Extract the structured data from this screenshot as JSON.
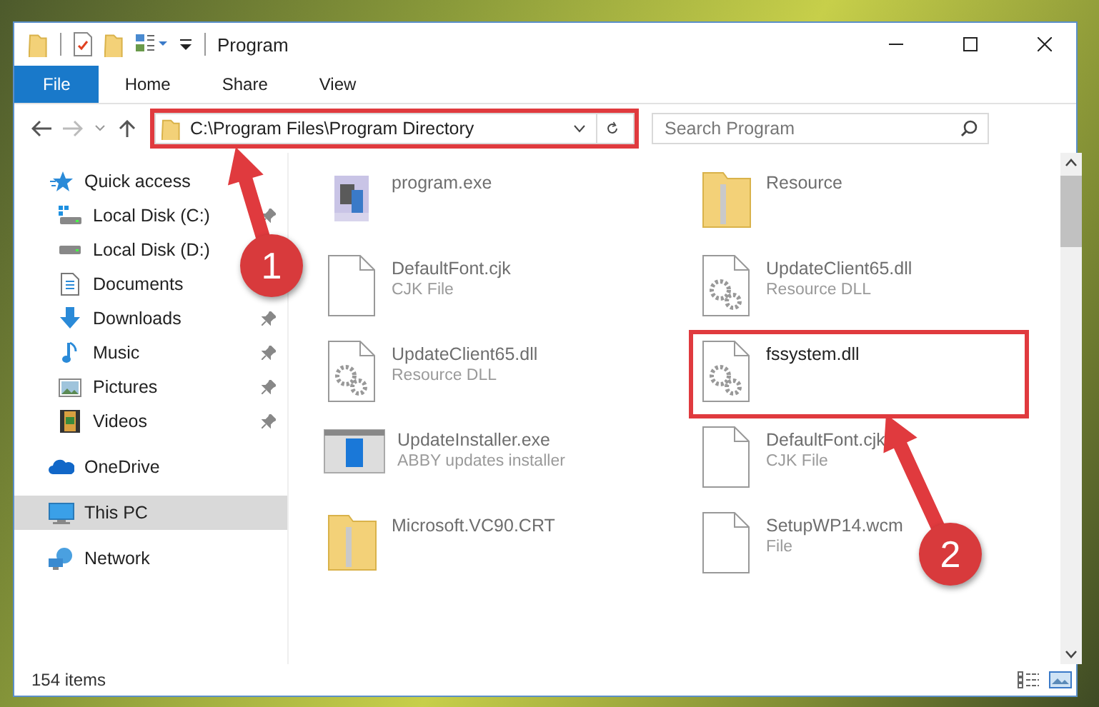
{
  "window": {
    "title": "Program"
  },
  "ribbon_tabs": [
    {
      "label": "File",
      "selected": true
    },
    {
      "label": "Home",
      "selected": false
    },
    {
      "label": "Share",
      "selected": false
    },
    {
      "label": "View",
      "selected": false
    }
  ],
  "address": {
    "path": "C:\\Program Files\\Program Directory",
    "highlighted": true
  },
  "search": {
    "placeholder": "Search Program"
  },
  "sidebar": {
    "items": [
      {
        "label": "Quick access",
        "kind": "star",
        "selected": false,
        "children": [
          {
            "label": "Local Disk (C:)",
            "kind": "systemdrive",
            "selected": false,
            "pinned": true
          },
          {
            "label": "Local Disk (D:)",
            "kind": "drive",
            "selected": false,
            "pinned": false
          },
          {
            "label": "Documents",
            "kind": "documents",
            "selected": false,
            "pinned": false
          },
          {
            "label": "Downloads",
            "kind": "downloads",
            "selected": false,
            "pinned": true
          },
          {
            "label": "Music",
            "kind": "music",
            "selected": false,
            "pinned": true
          },
          {
            "label": "Pictures",
            "kind": "pictures",
            "selected": false,
            "pinned": true
          },
          {
            "label": "Videos",
            "kind": "videos",
            "selected": false,
            "pinned": true
          }
        ]
      },
      {
        "label": "OneDrive",
        "kind": "cloud",
        "selected": false
      },
      {
        "label": "This PC",
        "kind": "computer",
        "selected": true
      },
      {
        "label": "Network",
        "kind": "network",
        "selected": false
      }
    ]
  },
  "files": [
    {
      "name": "program.exe",
      "kind": "app",
      "blurred": true,
      "highlighted": false
    },
    {
      "name": "Resource",
      "kind": "folder",
      "blurred": true,
      "highlighted": false
    },
    {
      "name": "DefaultFont.cjk",
      "type": "CJK File",
      "kind": "file",
      "blurred": true,
      "highlighted": false
    },
    {
      "name": "UpdateClient65.dll",
      "type": "Resource DLL",
      "kind": "dll",
      "blurred": true,
      "highlighted": false
    },
    {
      "name": "UpdateClient65.dll",
      "type": "Resource DLL",
      "kind": "dll",
      "blurred": true,
      "highlighted": false
    },
    {
      "name": "fssystem.dll",
      "kind": "dll",
      "blurred": false,
      "highlighted": true
    },
    {
      "name": "UpdateInstaller.exe",
      "type": "ABBY updates installer",
      "kind": "installer",
      "blurred": true,
      "highlighted": false
    },
    {
      "name": "DefaultFont.cjk",
      "type": "CJK File",
      "kind": "file",
      "blurred": true,
      "highlighted": false
    },
    {
      "name": "Microsoft.VC90.CRT",
      "kind": "folder",
      "blurred": true,
      "highlighted": false
    },
    {
      "name": "SetupWP14.wcm",
      "type": "File",
      "kind": "file",
      "blurred": true,
      "highlighted": false
    }
  ],
  "status_bar": {
    "count": "154 items"
  },
  "annotations": [
    {
      "number": "1"
    },
    {
      "number": "2"
    }
  ]
}
